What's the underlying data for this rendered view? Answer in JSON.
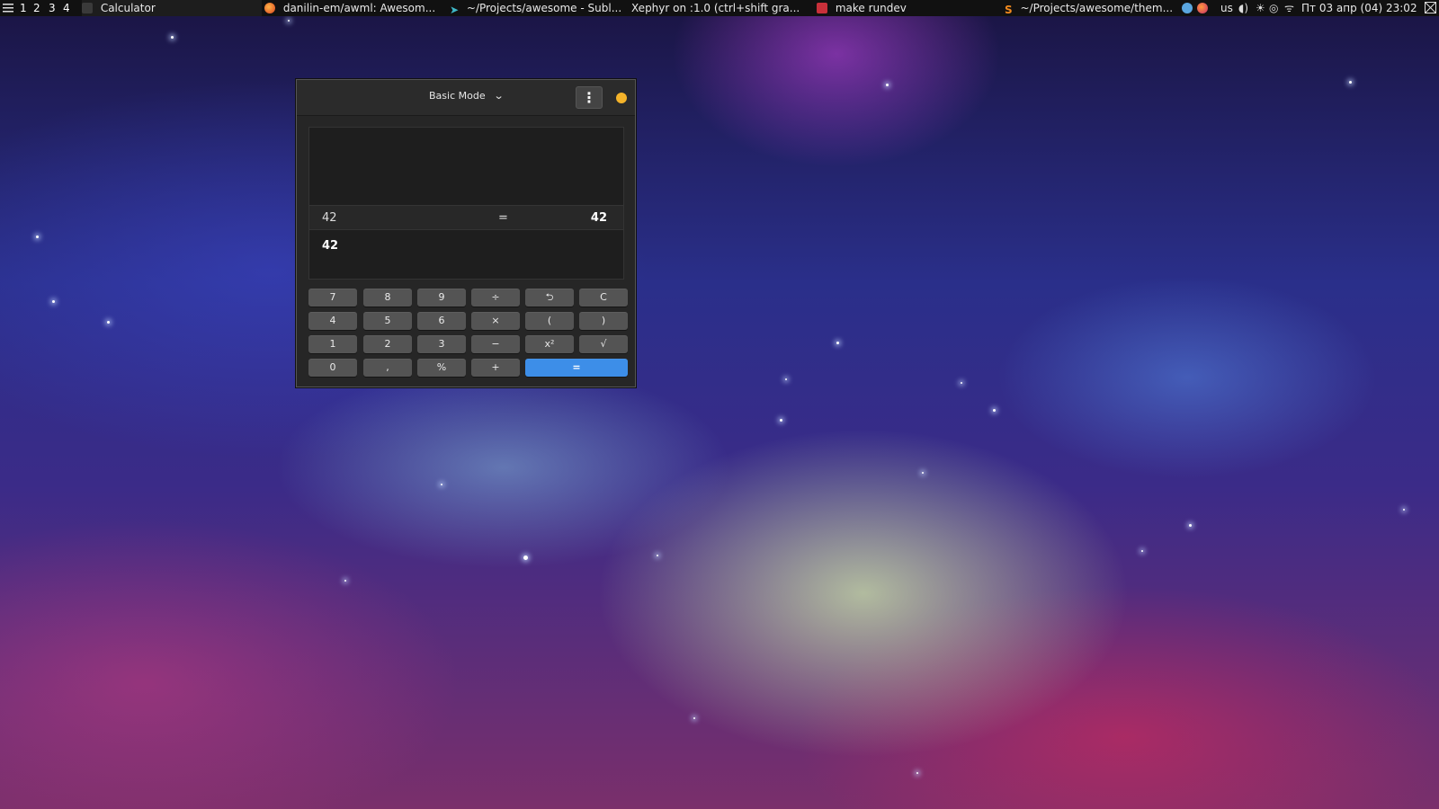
{
  "panel": {
    "layout_icon": "menu-grid-icon",
    "tags": [
      "1",
      "2",
      "3",
      "4"
    ],
    "active_tag": "1",
    "tasks": [
      {
        "icon": "calculator-icon",
        "title": "Calculator"
      },
      {
        "icon": "firefox-icon",
        "title": "danilin-em/awml: Awesom..."
      },
      {
        "icon": "terminal-icon",
        "title": "~/Projects/awesome - Subl..."
      },
      {
        "icon": "",
        "title": "Xephyr on :1.0 (ctrl+shift gra..."
      },
      {
        "icon": "make-icon",
        "title": "make rundev"
      },
      {
        "icon": "sublime-icon",
        "title": "~/Projects/awesome/them..."
      }
    ],
    "tray": {
      "keyboard_layout": "us",
      "datetime": "Пт 03 апр (04) 23:02"
    }
  },
  "calculator": {
    "mode_label": "Basic Mode",
    "history": {
      "expression": "42",
      "equals": "=",
      "result": "42"
    },
    "entry": "42",
    "keys": [
      [
        "7",
        "8",
        "9",
        "÷",
        "⮌",
        "C"
      ],
      [
        "4",
        "5",
        "6",
        "×",
        "(",
        ")"
      ],
      [
        "1",
        "2",
        "3",
        "−",
        "x²",
        "√"
      ],
      [
        "0",
        ",",
        "%",
        "+",
        "="
      ]
    ]
  },
  "colors": {
    "accent": "#3d8ee8",
    "close_button": "#f4b32a",
    "window_bg": "#262626",
    "key_bg": "#545454"
  }
}
